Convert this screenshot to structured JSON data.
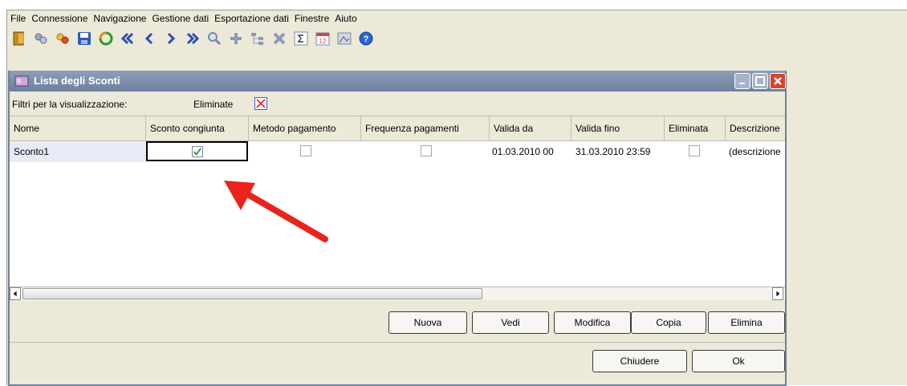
{
  "menu": [
    "File",
    "Connessione",
    "Navigazione",
    "Gestione dati",
    "Esportazione dati",
    "Finestre",
    "Aiuto"
  ],
  "toolbar_icons": [
    "exit-icon",
    "connect-icon",
    "disconnect-icon",
    "save-icon",
    "refresh-icon",
    "first-record-icon",
    "previous-record-icon",
    "next-record-icon",
    "last-record-icon",
    "search-icon",
    "add-icon",
    "tree-icon",
    "delete-icon",
    "sum-icon",
    "calendar-icon",
    "image-icon",
    "help-icon"
  ],
  "calendar_day": "12",
  "window": {
    "title": "Lista degli Sconti"
  },
  "filters": {
    "label": "Filtri per la visualizzazione:",
    "eliminate_label": "Eliminate",
    "eliminate_checked": true
  },
  "table": {
    "columns": [
      "Nome",
      "Sconto congiunta",
      "Metodo pagamento",
      "Frequenza pagamenti",
      "Valida da",
      "Valida fino",
      "Eliminata",
      "Descrizione"
    ],
    "rows": [
      {
        "nome": "Sconto1",
        "sconto_congiunta": true,
        "metodo_pagamento": false,
        "frequenza_pagamenti": false,
        "valida_da": "01.03.2010 00",
        "valida_fino": "31.03.2010 23:59",
        "eliminata": false,
        "descrizione": "(descrizione"
      }
    ]
  },
  "buttons": {
    "nuova": "Nuova",
    "vedi": "Vedi",
    "modifica": "Modifica",
    "copia": "Copia",
    "elimina": "Elimina",
    "chiudere": "Chiudere",
    "ok": "Ok"
  },
  "colors": {
    "titlebar": "#7a8aa8",
    "window_bg": "#ece9d8",
    "arrow": "#e8241c",
    "close_button": "#d8432a"
  }
}
